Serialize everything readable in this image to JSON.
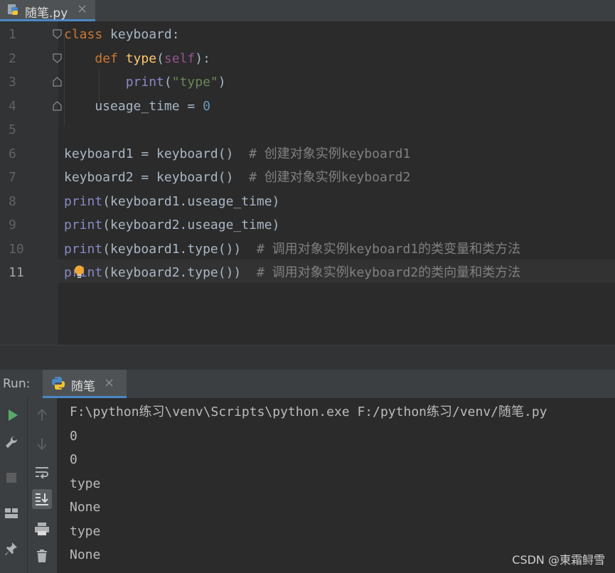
{
  "editor_tab": {
    "icon": "python-file-icon",
    "filename": "随笔.py",
    "close": "×"
  },
  "code": {
    "line_numbers": [
      "1",
      "2",
      "3",
      "4",
      "5",
      "6",
      "7",
      "8",
      "9",
      "10",
      "11"
    ],
    "lines": [
      [
        {
          "t": "kw",
          "v": "class"
        },
        {
          "t": "pl",
          "v": " keyboard:"
        }
      ],
      [
        {
          "t": "pl",
          "v": "    "
        },
        {
          "t": "kw",
          "v": "def"
        },
        {
          "t": "pl",
          "v": " "
        },
        {
          "t": "fn",
          "v": "type"
        },
        {
          "t": "pl",
          "v": "("
        },
        {
          "t": "self",
          "v": "self"
        },
        {
          "t": "pl",
          "v": "):"
        }
      ],
      [
        {
          "t": "pl",
          "v": "        "
        },
        {
          "t": "bi",
          "v": "print"
        },
        {
          "t": "pl",
          "v": "("
        },
        {
          "t": "str",
          "v": "\"type\""
        },
        {
          "t": "pl",
          "v": ")"
        }
      ],
      [
        {
          "t": "pl",
          "v": "    useage_time = "
        },
        {
          "t": "num",
          "v": "0"
        }
      ],
      [],
      [
        {
          "t": "pl",
          "v": "keyboard1 = keyboard()  "
        },
        {
          "t": "cm",
          "v": "# 创建对象实例keyboard1"
        }
      ],
      [
        {
          "t": "pl",
          "v": "keyboard2 = keyboard()  "
        },
        {
          "t": "cm",
          "v": "# 创建对象实例keyboard2"
        }
      ],
      [
        {
          "t": "bi",
          "v": "print"
        },
        {
          "t": "pl",
          "v": "(keyboard1.useage_time)"
        }
      ],
      [
        {
          "t": "bi",
          "v": "print"
        },
        {
          "t": "pl",
          "v": "(keyboard2.useage_time)"
        }
      ],
      [
        {
          "t": "bi",
          "v": "print"
        },
        {
          "t": "pl",
          "v": "(keyboard1.type())  "
        },
        {
          "t": "cm",
          "v": "# 调用对象实例keyboard1的类变量和类方法"
        }
      ],
      [
        {
          "t": "bi",
          "v": "print"
        },
        {
          "t": "pl",
          "v": "(keyboard2.type())  "
        },
        {
          "t": "cm",
          "v": "# 调用对象实例keyboard2的类向量和类方法"
        }
      ]
    ]
  },
  "run_panel": {
    "title": "Run:",
    "tab_label": "随笔",
    "tab_close": "×",
    "output": [
      "F:\\python练习\\venv\\Scripts\\python.exe F:/python练习/venv/随笔.py",
      "0",
      "0",
      "type",
      "None",
      "type",
      "None"
    ]
  },
  "toolbar_icons": [
    "run-icon",
    "wrench-icon",
    "stop-icon",
    "layout-icon",
    "pin-icon",
    "up-arrow-icon",
    "down-arrow-icon",
    "soft-wrap-icon",
    "scroll-to-end-icon",
    "print-icon",
    "trash-icon"
  ],
  "watermark": "CSDN @東霜鲟雪",
  "colors": {
    "keyword": "#cc7832",
    "function": "#ffc66d",
    "string": "#6a8759",
    "number": "#6897bb",
    "builtin": "#8888c6",
    "comment": "#808080",
    "self": "#94558d"
  }
}
